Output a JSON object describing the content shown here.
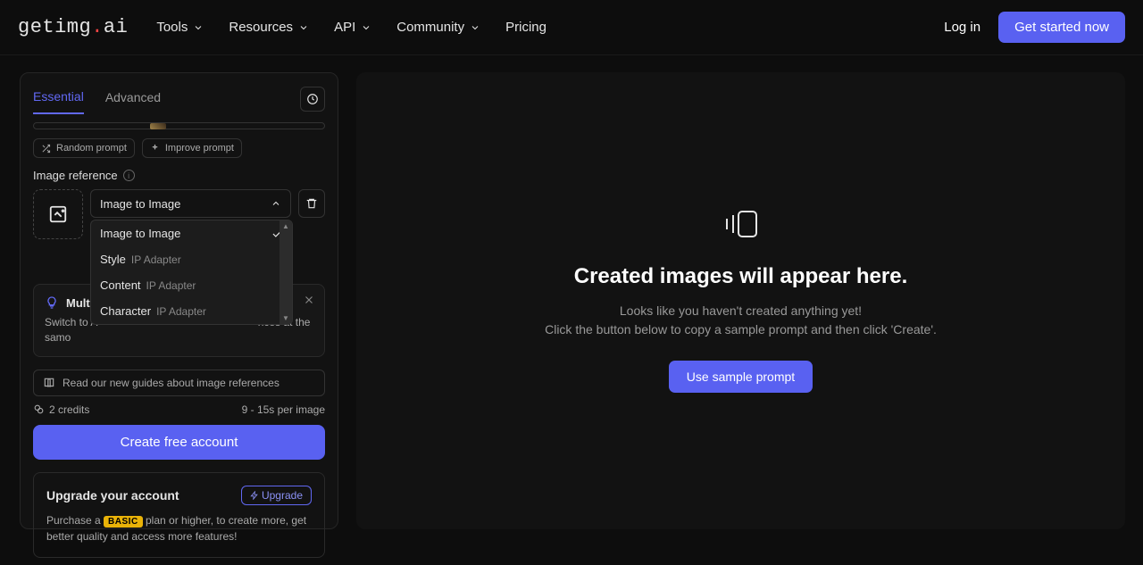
{
  "logo": {
    "text": "getimg",
    "dot": ".",
    "suffix": "ai"
  },
  "nav": {
    "tools": "Tools",
    "resources": "Resources",
    "api": "API",
    "community": "Community",
    "pricing": "Pricing"
  },
  "header": {
    "login": "Log in",
    "cta": "Get started now"
  },
  "tabs": {
    "essential": "Essential",
    "advanced": "Advanced"
  },
  "prompts": {
    "random": "Random prompt",
    "improve": "Improve prompt"
  },
  "ref": {
    "label": "Image reference",
    "selected": "Image to Image",
    "options": [
      {
        "label": "Image to Image",
        "sub": ""
      },
      {
        "label": "Style",
        "sub": "IP Adapter"
      },
      {
        "label": "Content",
        "sub": "IP Adapter"
      },
      {
        "label": "Character",
        "sub": "IP Adapter"
      }
    ]
  },
  "tip": {
    "title": "Multip",
    "text1": "Switch to A",
    "text2": "nces at the samo"
  },
  "guide": "Read our new guides about image references",
  "credits": {
    "amount": "2 credits",
    "time": "9 - 15s per image"
  },
  "create": "Create free account",
  "upgrade": {
    "title": "Upgrade your account",
    "btn": "Upgrade",
    "text1": "Purchase a ",
    "badge": "BASIC",
    "text2": " plan or higher, to create more, get better quality and access more features!"
  },
  "empty": {
    "title": "Created images will appear here.",
    "text": "Looks like you haven't created anything yet!\nClick the button below to copy a sample prompt and then click 'Create'.",
    "btn": "Use sample prompt"
  }
}
